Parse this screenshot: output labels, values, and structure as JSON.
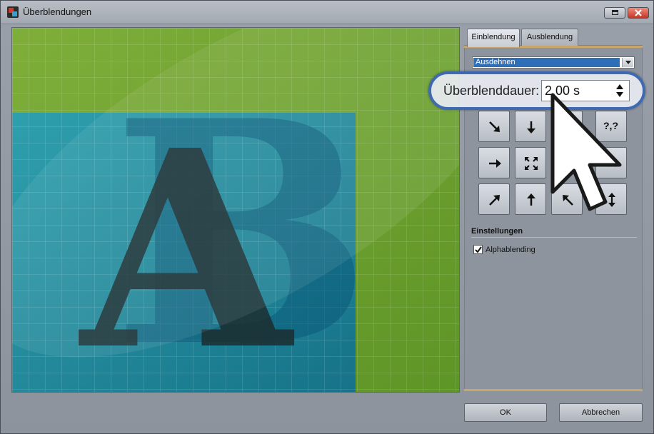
{
  "window": {
    "title": "Überblendungen"
  },
  "tabs": [
    {
      "label": "Einblendung",
      "active": true
    },
    {
      "label": "Ausblendung",
      "active": false
    }
  ],
  "transition_type": {
    "selected": "Ausdehnen"
  },
  "duration": {
    "label": "Überblenddauer:",
    "value": "2,00 s"
  },
  "preview": {
    "letter_a": "A",
    "letter_b": "B",
    "background_color": "#6fa12e",
    "overlay_color": "#1a8aa3"
  },
  "direction_buttons": [
    {
      "icon": "arrow-down-right-icon"
    },
    {
      "icon": "arrow-down-icon"
    },
    {
      "icon": "arrow-down-left-icon"
    },
    {
      "icon": "random-icon",
      "text": "?,?"
    },
    {
      "icon": "arrow-right-icon"
    },
    {
      "icon": "expand-from-center-icon"
    },
    {
      "icon": "arrow-left-icon"
    },
    {
      "icon": "arrow-left-right-icon"
    },
    {
      "icon": "arrow-up-right-icon"
    },
    {
      "icon": "arrow-up-icon"
    },
    {
      "icon": "arrow-up-left-icon"
    },
    {
      "icon": "arrow-up-down-icon"
    }
  ],
  "settings": {
    "heading": "Einstellungen",
    "alphablending": {
      "label": "Alphablending",
      "checked": true
    }
  },
  "footer": {
    "ok_label": "OK",
    "cancel_label": "Abbrechen"
  },
  "colors": {
    "accent": "#c9a66b",
    "callout_border": "#3f69b0",
    "selection": "#2f6fb8"
  }
}
